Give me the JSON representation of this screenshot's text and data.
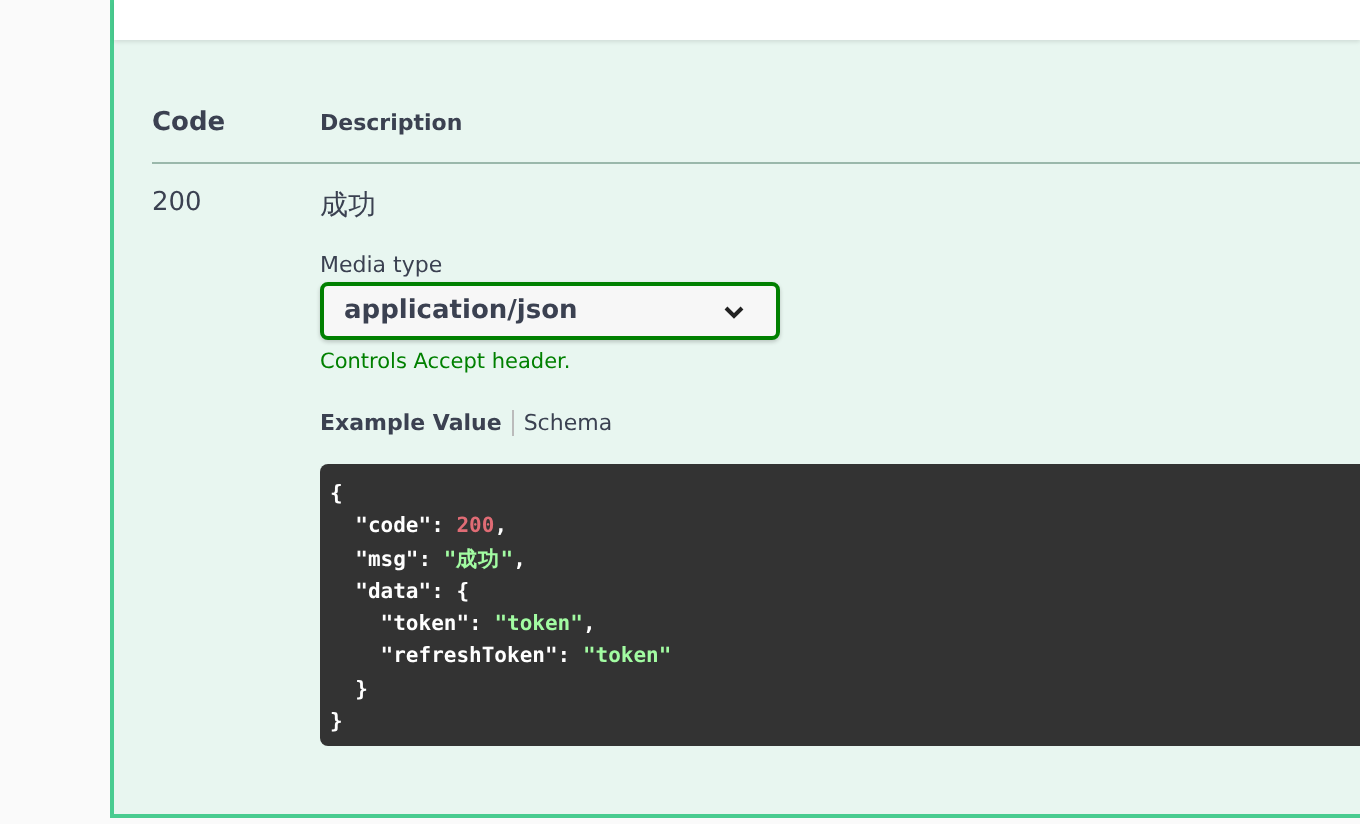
{
  "responses": {
    "columns": [
      "Code",
      "Description"
    ],
    "rows": [
      {
        "code": "200",
        "description": "成功",
        "media_type": {
          "label": "Media type",
          "value": "application/json",
          "hint": "Controls Accept header."
        },
        "tabs": [
          {
            "label": "Example Value",
            "selected": true
          },
          {
            "label": "Schema",
            "selected": false
          }
        ],
        "example": [
          [
            {
              "text": "{",
              "kind": "punct"
            }
          ],
          [
            {
              "text": "  \"code\"",
              "kind": "key"
            },
            {
              "text": ": ",
              "kind": "punct"
            },
            {
              "text": "200",
              "kind": "number"
            },
            {
              "text": ",",
              "kind": "punct"
            }
          ],
          [
            {
              "text": "  \"msg\"",
              "kind": "key"
            },
            {
              "text": ": ",
              "kind": "punct"
            },
            {
              "text": "\"成功\"",
              "kind": "string"
            },
            {
              "text": ",",
              "kind": "punct"
            }
          ],
          [
            {
              "text": "  \"data\"",
              "kind": "key"
            },
            {
              "text": ": {",
              "kind": "punct"
            }
          ],
          [
            {
              "text": "    \"token\"",
              "kind": "key"
            },
            {
              "text": ": ",
              "kind": "punct"
            },
            {
              "text": "\"token\"",
              "kind": "string"
            },
            {
              "text": ",",
              "kind": "punct"
            }
          ],
          [
            {
              "text": "    \"refreshToken\"",
              "kind": "key"
            },
            {
              "text": ": ",
              "kind": "punct"
            },
            {
              "text": "\"token\"",
              "kind": "string"
            }
          ],
          [
            {
              "text": "  }",
              "kind": "punct"
            }
          ],
          [
            {
              "text": "}",
              "kind": "punct"
            }
          ]
        ]
      }
    ]
  }
}
